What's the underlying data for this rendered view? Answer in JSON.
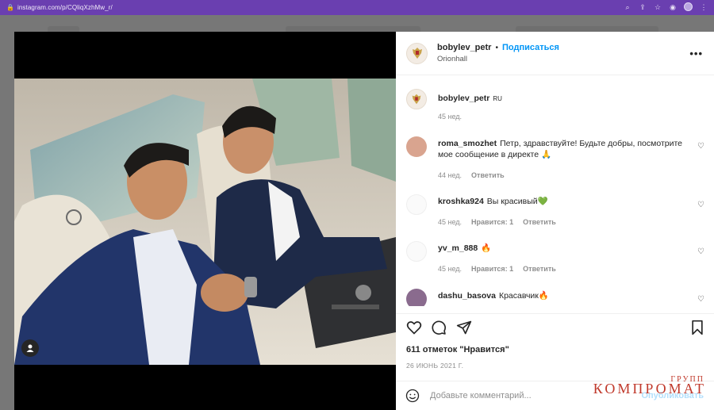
{
  "browser": {
    "url": "instagram.com/p/CQliqXzhMw_r/"
  },
  "post": {
    "author": "bobylev_petr",
    "separator": "•",
    "follow_label": "Подписаться",
    "location": "Orionhall",
    "more_label": "•••",
    "caption_author": "bobylev_petr",
    "caption_text": "RU",
    "caption_time": "45 нед.",
    "likes": "611 отметок \"Нравится\"",
    "date": "26 ИЮНЬ 2021 Г.",
    "comment_placeholder": "Добавьте комментарий...",
    "publish_label": "Опубликовать"
  },
  "comments": [
    {
      "user": "roma_smozhet",
      "text": "Петр, здравствуйте! Будьте добры, посмотрите мое сообщение в директе 🙏",
      "time": "44 нед.",
      "likes": "",
      "reply": "Ответить"
    },
    {
      "user": "kroshka924",
      "text": "Вы красивый💚",
      "time": "45 нед.",
      "likes": "Нравится: 1",
      "reply": "Ответить"
    },
    {
      "user": "yv_m_888",
      "text": "🔥",
      "time": "45 нед.",
      "likes": "Нравится: 1",
      "reply": "Ответить"
    },
    {
      "user": "dashu_basova",
      "text": "Красавчик🔥",
      "time": "",
      "likes": "",
      "reply": ""
    }
  ],
  "watermark": {
    "small": "ГРУПП",
    "big": "КОМПРОМАТ"
  },
  "colors": {
    "browser_bar": "#6a3fb0",
    "follow_blue": "#0095f6",
    "watermark_red": "#c0392b"
  }
}
